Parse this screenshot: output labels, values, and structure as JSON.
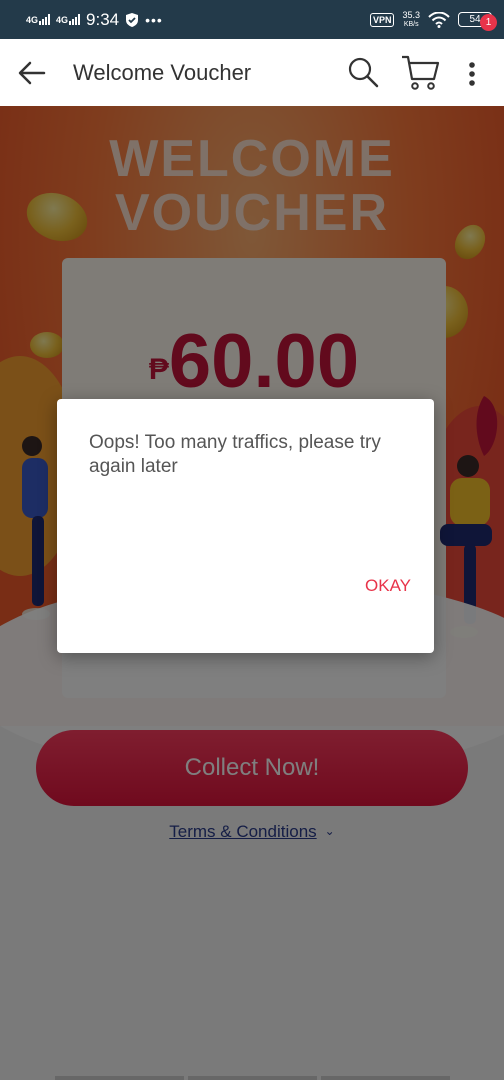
{
  "status_bar": {
    "network1": "4G",
    "network2": "4G",
    "time": "9:34",
    "vpn": "VPN",
    "speed_value": "35.3",
    "speed_unit": "KB/s",
    "battery": "54"
  },
  "appbar": {
    "title": "Welcome Voucher",
    "cart_badge": "1"
  },
  "banner": {
    "title_line1": "WELCOME",
    "title_line2": "VOUCHER",
    "currency": "₱",
    "amount": "60.00"
  },
  "collect_button": "Collect Now!",
  "terms_link": "Terms & Conditions",
  "dialog": {
    "message": "Oops! Too many traffics, please try again later",
    "ok_label": "OKAY"
  },
  "colors": {
    "accent": "#e8344a",
    "status_bar": "#233a4a"
  }
}
